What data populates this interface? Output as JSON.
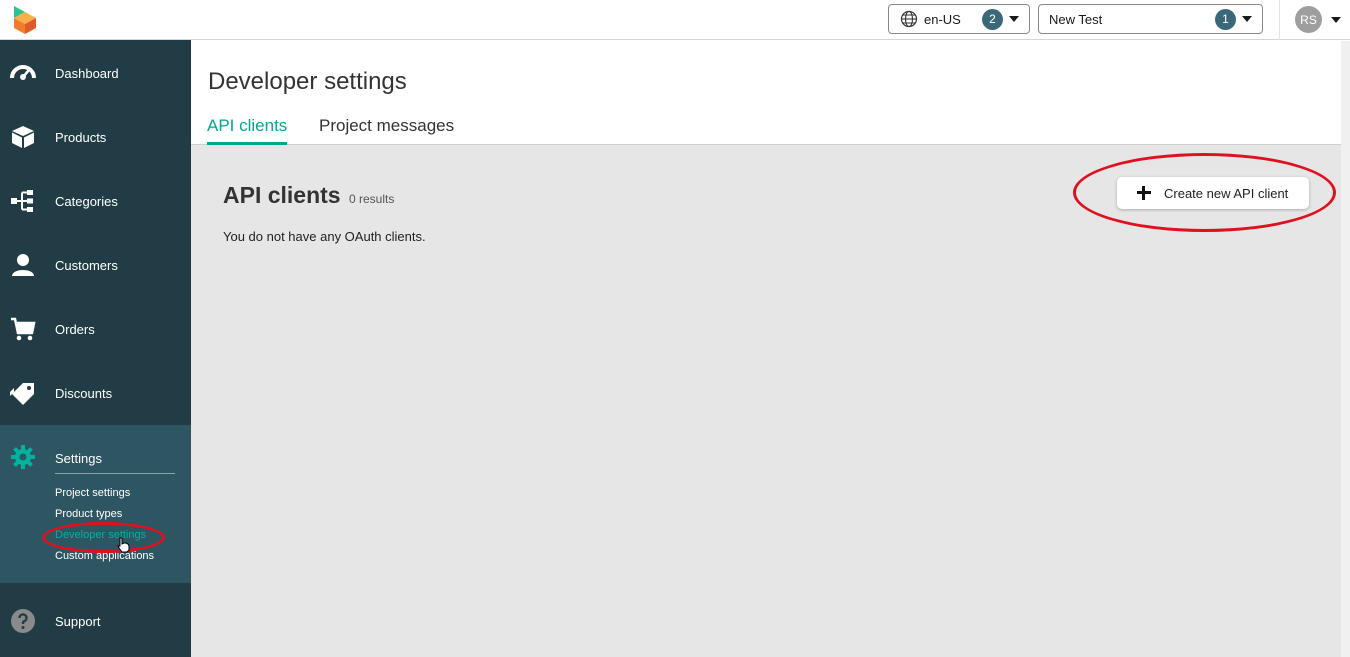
{
  "topbar": {
    "language": {
      "value": "en-US",
      "count": "2"
    },
    "project": {
      "value": "New Test",
      "count": "1"
    },
    "user_initials": "RS"
  },
  "sidebar": {
    "items": [
      {
        "label": "Dashboard",
        "icon": "dashboard-icon"
      },
      {
        "label": "Products",
        "icon": "box-icon"
      },
      {
        "label": "Categories",
        "icon": "tree-icon"
      },
      {
        "label": "Customers",
        "icon": "person-icon"
      },
      {
        "label": "Orders",
        "icon": "cart-icon"
      },
      {
        "label": "Discounts",
        "icon": "tag-icon"
      }
    ],
    "settings": {
      "label": "Settings",
      "icon": "gear-icon",
      "sub_items": [
        {
          "label": "Project settings"
        },
        {
          "label": "Product types"
        },
        {
          "label": "Developer settings",
          "active": true
        },
        {
          "label": "Custom applications"
        }
      ]
    },
    "support": {
      "label": "Support",
      "icon": "help-icon"
    }
  },
  "main": {
    "title": "Developer settings",
    "tabs": [
      {
        "label": "API clients",
        "active": true
      },
      {
        "label": "Project messages"
      }
    ],
    "section_title": "API clients",
    "results": "0 results",
    "empty_message": "You do not have any OAuth clients.",
    "create_button": "Create new API client"
  },
  "colors": {
    "sidebar_bg": "#213c45",
    "settings_bg": "#2e5562",
    "accent": "#00a88f",
    "annotation": "#e0101e",
    "badge": "#3a6878"
  }
}
